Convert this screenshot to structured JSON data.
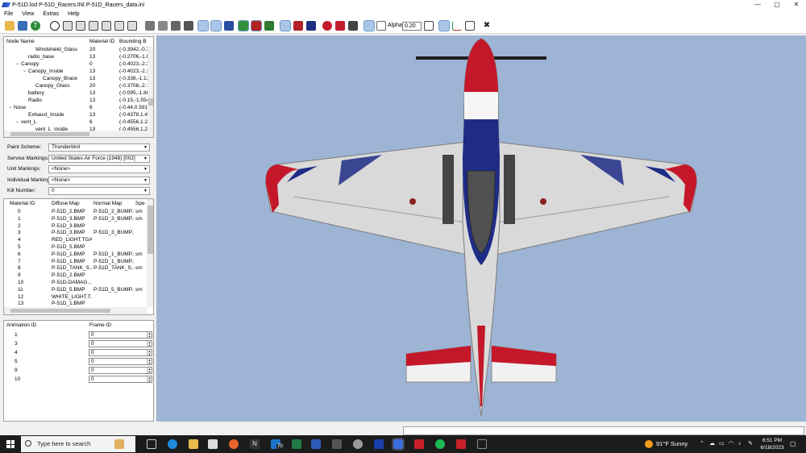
{
  "window": {
    "title": "P-51D.lod  P-51D_Racers.INI  P-51D_Racers_data.ini",
    "controls": {
      "minimize": "—",
      "maximize": "▢",
      "close": "✕"
    }
  },
  "menu": [
    "File",
    "View",
    "Extras",
    "Help"
  ],
  "toolbar": {
    "alpha_label": "Alpha:",
    "alpha_value": "0.20"
  },
  "node_tree": {
    "columns": [
      "Node Name",
      "Material ID",
      "Bounding B"
    ],
    "rows": [
      {
        "indent": 4,
        "twisty": "",
        "name": "Windshield_Glass",
        "mat": "20",
        "bb": "(-0.3942,-0.3"
      },
      {
        "indent": 3,
        "twisty": "",
        "name": "radio_base",
        "mat": "13",
        "bb": "(-0.2706,-1.8"
      },
      {
        "indent": 2,
        "twisty": "⌄",
        "name": "Canopy",
        "mat": "0",
        "bb": "(-0.4023,-2.3"
      },
      {
        "indent": 3,
        "twisty": "⌄",
        "name": "Canopy_Inside",
        "mat": "13",
        "bb": "(-0.4023,-2.3"
      },
      {
        "indent": 5,
        "twisty": "",
        "name": "Canopy_Brace",
        "mat": "13",
        "bb": "(-0.338,-1.13"
      },
      {
        "indent": 4,
        "twisty": "",
        "name": "Canopy_Glass",
        "mat": "20",
        "bb": "(-0.3708,-2.1"
      },
      {
        "indent": 3,
        "twisty": "",
        "name": "battery",
        "mat": "13",
        "bb": "(-0.095,-1.86"
      },
      {
        "indent": 3,
        "twisty": "",
        "name": "Radio",
        "mat": "13",
        "bb": "(-0.15,-1.554"
      },
      {
        "indent": 1,
        "twisty": "⌄",
        "name": "Nose",
        "mat": "6",
        "bb": "(-0.44,0.5912"
      },
      {
        "indent": 3,
        "twisty": "",
        "name": "Exhaust_Inside",
        "mat": "13",
        "bb": "(-0.4378,1.43"
      },
      {
        "indent": 2,
        "twisty": "⌄",
        "name": "vent_L",
        "mat": "6",
        "bb": "(-0.4556,1.21"
      },
      {
        "indent": 4,
        "twisty": "",
        "name": "vent_L_inside",
        "mat": "13",
        "bb": "(-0.4556,1.21"
      }
    ]
  },
  "markings": [
    {
      "label": "Paint Scheme:",
      "value": "Thunderbird"
    },
    {
      "label": "Service Markings:",
      "value": "United States Air Force (1948) [002]"
    },
    {
      "label": "Unit Markings:",
      "value": "<None>"
    },
    {
      "label": "Individual Markings:",
      "value": "<None>"
    },
    {
      "label": "Kill Number:",
      "value": "0"
    }
  ],
  "materials": {
    "columns": [
      "Material ID",
      "Diffuse Map",
      "Normal Map",
      "Spe"
    ],
    "rows": [
      [
        "0",
        "P-51D_2.BMP",
        "P-51D_2_BUMP....",
        "sm"
      ],
      [
        "1",
        "P-51D_3.BMP",
        "P-51D_3_BUMP....",
        "sm"
      ],
      [
        "2",
        "P-51D_3.BMP",
        "",
        ""
      ],
      [
        "3",
        "P-51D_3.BMP",
        "P-51D_3_BUMP....",
        ""
      ],
      [
        "4",
        "RED_LIGHT.TGA",
        "",
        ""
      ],
      [
        "5",
        "P-51D_5.BMP",
        "",
        ""
      ],
      [
        "6",
        "P-51D_1.BMP",
        "P-51D_1_BUMP....",
        "sm"
      ],
      [
        "7",
        "P-51D_1.BMP",
        "P-51D_1_BUMP....",
        ""
      ],
      [
        "8",
        "P-51D_TANK_S...",
        "P-51D_TANK_S...",
        "sm"
      ],
      [
        "9",
        "P-51D_2.BMP",
        "",
        ""
      ],
      [
        "10",
        "P-51D-DAMAG...",
        "",
        ""
      ],
      [
        "11",
        "P-51D_5.BMP",
        "P-51D_5_BUMP....",
        "sm"
      ],
      [
        "12",
        "WHITE_LIGHT.T...",
        "",
        ""
      ],
      [
        "13",
        "P-51D_1.BMP",
        "",
        ""
      ]
    ]
  },
  "animations": {
    "columns": [
      "Animation ID",
      "Frame ID"
    ],
    "rows": [
      [
        "1",
        "0"
      ],
      [
        "3",
        "0"
      ],
      [
        "4",
        "0"
      ],
      [
        "5",
        "0"
      ],
      [
        "9",
        "0"
      ],
      [
        "10",
        "0"
      ]
    ]
  },
  "taskbar": {
    "search_placeholder": "Type here to search",
    "badge": "70",
    "weather": "91°F  Sunny",
    "time": "6:51 PM",
    "date": "6/18/2023"
  },
  "colors": {
    "viewport_bg": "#9eb4d5",
    "red": "#c4182a",
    "blue": "#1e2c86",
    "silver": "#d9d9d9"
  }
}
